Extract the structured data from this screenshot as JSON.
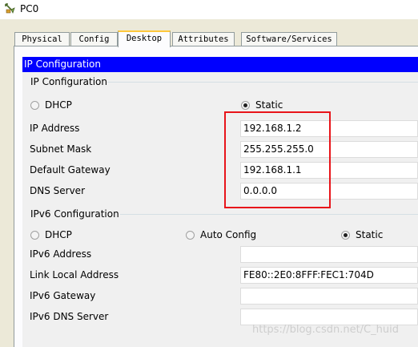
{
  "window": {
    "title": "PC0",
    "icon": "packet-tracer-pc-icon"
  },
  "tabs": [
    {
      "label": "Physical",
      "active": false
    },
    {
      "label": "Config",
      "active": false
    },
    {
      "label": "Desktop",
      "active": true
    },
    {
      "label": "Attributes",
      "active": false
    },
    {
      "label": "Software/Services",
      "active": false
    }
  ],
  "panel": {
    "header": "IP Configuration"
  },
  "ipv4": {
    "group_label": "IP Configuration",
    "dhcp_label": "DHCP",
    "static_label": "Static",
    "mode": "Static",
    "fields": [
      {
        "label": "IP Address",
        "value": "192.168.1.2"
      },
      {
        "label": "Subnet Mask",
        "value": "255.255.255.0"
      },
      {
        "label": "Default Gateway",
        "value": "192.168.1.1"
      },
      {
        "label": "DNS Server",
        "value": "0.0.0.0"
      }
    ]
  },
  "ipv6": {
    "group_label": "IPv6 Configuration",
    "dhcp_label": "DHCP",
    "auto_label": "Auto Config",
    "static_label": "Static",
    "mode": "Static",
    "fields": [
      {
        "label": "IPv6 Address",
        "value": ""
      },
      {
        "label": "Link Local Address",
        "value": "FE80::2E0:8FFF:FEC1:704D"
      },
      {
        "label": "IPv6 Gateway",
        "value": ""
      },
      {
        "label": "IPv6 DNS Server",
        "value": ""
      }
    ]
  },
  "annotation": {
    "color": "#e8141a"
  },
  "watermark": "https://blog.csdn.net/C_huid"
}
